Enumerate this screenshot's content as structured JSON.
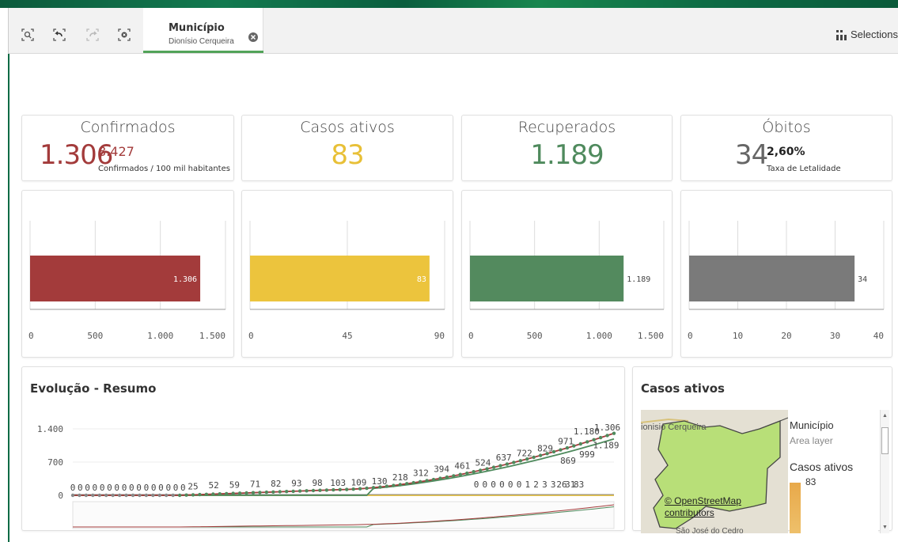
{
  "toolbar": {
    "selection_field": "Município",
    "selection_value": "Dionísio Cerqueira",
    "selections_label": "Selections"
  },
  "kpis": {
    "confirmados": {
      "title": "Confirmados",
      "value": "1.306",
      "sub_value": "8.427",
      "sub_label": "Confirmados / 100 mil habitantes",
      "color": "#a33b3b"
    },
    "ativos": {
      "title": "Casos ativos",
      "value": "83",
      "color": "#e8c037"
    },
    "recuperados": {
      "title": "Recuperados",
      "value": "1.189",
      "color": "#4f8a5d"
    },
    "obitos": {
      "title": "Óbitos",
      "value": "34",
      "sub_value": "2,60%",
      "sub_label": "Taxa de Letalidade",
      "color": "#666666"
    }
  },
  "bar_charts": [
    {
      "label": "1.306",
      "value": 1306,
      "max": 1500,
      "ticks": [
        {
          "v": 0,
          "t": "0"
        },
        {
          "v": 500,
          "t": "500"
        },
        {
          "v": 1000,
          "t": "1.000"
        },
        {
          "v": 1500,
          "t": "1.500"
        }
      ],
      "color": "#a33b3b",
      "label_inside": true
    },
    {
      "label": "83",
      "value": 83,
      "max": 90,
      "ticks": [
        {
          "v": 0,
          "t": "0"
        },
        {
          "v": 45,
          "t": "45"
        },
        {
          "v": 90,
          "t": "90"
        }
      ],
      "color": "#ecc43d",
      "label_inside": true
    },
    {
      "label": "1.189",
      "value": 1189,
      "max": 1500,
      "ticks": [
        {
          "v": 0,
          "t": "0"
        },
        {
          "v": 500,
          "t": "500"
        },
        {
          "v": 1000,
          "t": "1.000"
        },
        {
          "v": 1500,
          "t": "1.500"
        }
      ],
      "color": "#538a5e",
      "label_inside": false
    },
    {
      "label": "34",
      "value": 34,
      "max": 40,
      "ticks": [
        {
          "v": 0,
          "t": "0"
        },
        {
          "v": 10,
          "t": "10"
        },
        {
          "v": 20,
          "t": "20"
        },
        {
          "v": 30,
          "t": "30"
        },
        {
          "v": 40,
          "t": "40"
        }
      ],
      "color": "#7a7a7a",
      "label_inside": false
    }
  ],
  "evolution": {
    "title": "Evolução - Resumo",
    "yticks": [
      "1.400",
      "700",
      "0"
    ],
    "confirmados_labels": [
      "0",
      "0",
      "0",
      "0",
      "0",
      "0",
      "0",
      "0",
      "0",
      "0",
      "0",
      "0",
      "0",
      "0",
      "0",
      "0",
      "25",
      "52",
      "59",
      "71",
      "82",
      "93",
      "98",
      "103",
      "109",
      "130",
      "218",
      "312",
      "394",
      "461",
      "524",
      "637",
      "722",
      "829",
      "971",
      "1.180",
      "1.306"
    ],
    "recuperados_labels": [
      "0",
      "0",
      "0",
      "0",
      "0",
      "0",
      "1",
      "2",
      "3",
      "3",
      "26",
      "31",
      "83",
      "869",
      "999",
      "1.189"
    ],
    "colors": {
      "confirmados": "#a33b3b",
      "recuperados": "#4f8a5d",
      "ativos": "#e8c037",
      "obitos": "#888888"
    }
  },
  "map": {
    "title": "Casos ativos",
    "place_label": "ionisio Cerqueira",
    "place_label_bottom": "São José do Cedro",
    "osm_line1": "© OpenStreetMap",
    "osm_line2": "contributors",
    "legend_title": "Município",
    "legend_sub": "Area layer",
    "legend_measure": "Casos ativos",
    "legend_value": "83",
    "legend_color": "#e8a94a"
  }
}
